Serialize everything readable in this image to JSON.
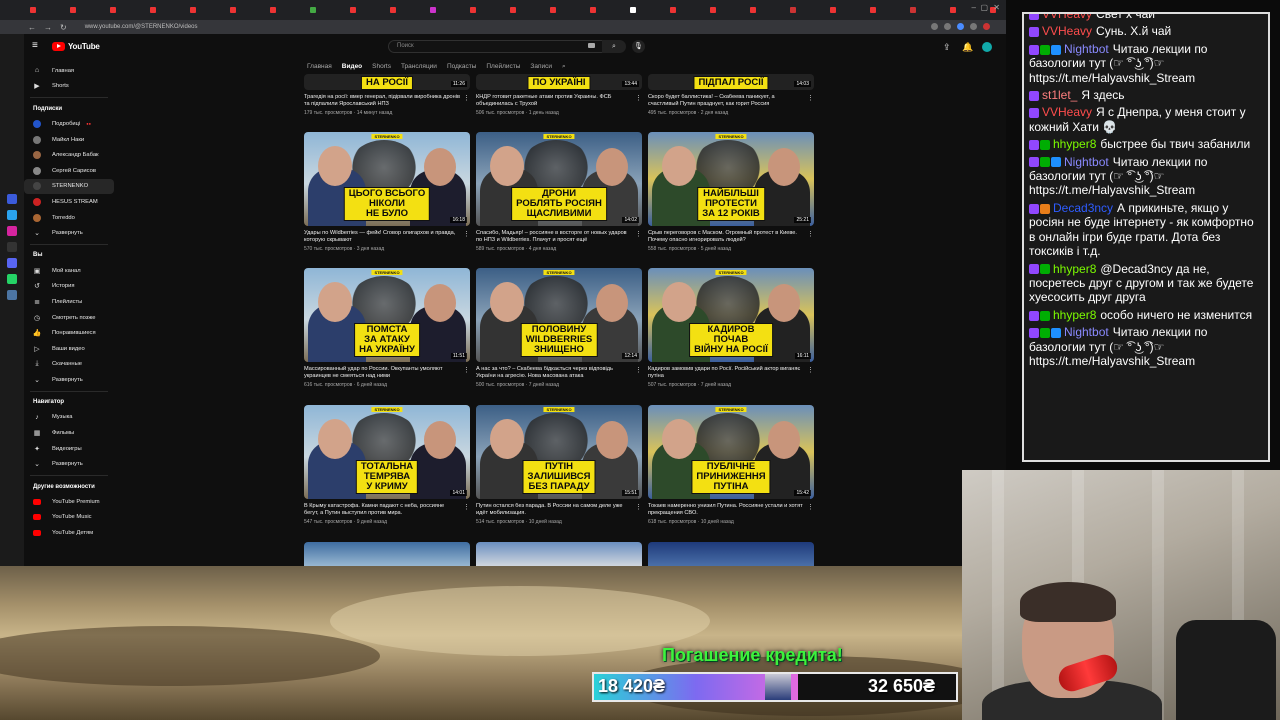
{
  "browser": {
    "url": "www.youtube.com/@STERNENKO/videos",
    "tab_count": 38
  },
  "youtube": {
    "logo": "YouTube",
    "search_placeholder": "Поиск",
    "tabs": [
      "Главная",
      "Видео",
      "Shorts",
      "Трансляции",
      "Подкасты",
      "Плейлисты",
      "Записи"
    ],
    "active_tab": "Видео"
  },
  "sidebar": {
    "main": [
      {
        "label": "Главная",
        "icon": "home-icon"
      },
      {
        "label": "Shorts",
        "icon": "shorts-icon"
      }
    ],
    "subs_title": "Подписки",
    "subs": [
      {
        "label": "Подробиці",
        "color": "#2255cc",
        "live": true
      },
      {
        "label": "Майкл Наки",
        "color": "#777777",
        "live": false
      },
      {
        "label": "Александр Бабак",
        "color": "#996644",
        "live": false
      },
      {
        "label": "Сергей Сарисов",
        "color": "#888888",
        "live": false
      },
      {
        "label": "STERNENKO",
        "color": "#444444",
        "live": false,
        "selected": true
      },
      {
        "label": "HESUS STREAM",
        "color": "#cc2222",
        "live": false
      },
      {
        "label": "Torreddo",
        "color": "#aa6633",
        "live": false
      },
      {
        "label": "Развернуть",
        "color": "",
        "live": false
      }
    ],
    "you_title": "Вы",
    "you": [
      {
        "label": "Мой канал",
        "icon": "user-icon"
      },
      {
        "label": "История",
        "icon": "history-icon"
      },
      {
        "label": "Плейлисты",
        "icon": "playlist-icon"
      },
      {
        "label": "Смотреть позже",
        "icon": "clock-icon"
      },
      {
        "label": "Понравившиеся",
        "icon": "like-icon"
      },
      {
        "label": "Ваши видео",
        "icon": "video-icon"
      },
      {
        "label": "Скачанные",
        "icon": "download-icon"
      },
      {
        "label": "Развернуть",
        "icon": "chevron-down-icon"
      }
    ],
    "nav_title": "Навигатор",
    "nav": [
      {
        "label": "Музыка",
        "icon": "music-icon"
      },
      {
        "label": "Фильмы",
        "icon": "film-icon"
      },
      {
        "label": "Видеоигры",
        "icon": "gamepad-icon"
      },
      {
        "label": "Развернуть",
        "icon": "chevron-down-icon"
      }
    ],
    "more_title": "Другие возможности",
    "more": [
      {
        "label": "YouTube Premium"
      },
      {
        "label": "YouTube Music"
      },
      {
        "label": "YouTube Детям"
      }
    ]
  },
  "top_row": [
    {
      "caption": "НА РОСІЇ",
      "title": "Трагедія на росії: вмер генерал, підірвали виробника дронів та підпалили Ярославський НПЗ",
      "meta": "179 тыс. просмотров · 14 минут назад",
      "dur": "11:26"
    },
    {
      "caption": "ПО УКРАЇНІ",
      "title": "КНДР готовит ракетные атаки против Украины. ФСБ объединилась с Трухой",
      "meta": "506 тыс. просмотров · 1 день назад",
      "dur": "13:44"
    },
    {
      "caption": "ПІДПАЛ РОСІЇ",
      "title": "Скоро будет баллистика! – Скабеева паникует, а счастливый Путин празднует, как горит Россия",
      "meta": "495 тыс. просмотров · 2 дня назад",
      "dur": "14:03"
    }
  ],
  "videos": [
    {
      "caption": [
        "ЦЬОГО ВСЬОГО",
        "НІКОЛИ",
        "НЕ БУЛО"
      ],
      "badge": "STERNENKO",
      "title": "Удары по Wildberries — фейк! Сговор олигархов и правда, которую скрывают",
      "meta": "570 тыс. просмотров · 3 дня назад",
      "dur": "16:18"
    },
    {
      "caption": [
        "ДРОНИ",
        "РОБЛЯТЬ РОСІЯН",
        "ЩАСЛИВИМИ"
      ],
      "badge": "STERNENKO",
      "title": "Спасибо, Мадьяр! – россияне в восторге от новых ударов по НПЗ и Wildberries. Плачут и просят ещё",
      "meta": "589 тыс. просмотров · 4 дня назад",
      "dur": "14:02"
    },
    {
      "caption": [
        "НАЙБІЛЬШІ",
        "ПРОТЕСТИ",
        "ЗА 12 РОКІВ"
      ],
      "badge": "STERNENKO",
      "title": "Срыв переговоров с Маском. Огромный протест в Киеве. Почему опасно игнорировать людей?",
      "meta": "558 тыс. просмотров · 5 дней назад",
      "dur": "25:21"
    },
    {
      "caption": [
        "ПОМСТА",
        "ЗА АТАКУ",
        "НА УКРАЇНУ"
      ],
      "badge": "STERNENKO",
      "title": "Массированный удар по России. Оккупанты умоляют украинцев не смеяться над ними",
      "meta": "616 тыс. просмотров · 6 дней назад",
      "dur": "11:51"
    },
    {
      "caption": [
        "ПОЛОВИНУ",
        "WILDBERRIES",
        "ЗНИЩЕНО"
      ],
      "badge": "STERNENKO",
      "title": "А нас за что? – Скабеева бідкається через відповідь України на агресію. Нова масована атака",
      "meta": "500 тыс. просмотров · 7 дней назад",
      "dur": "12:14"
    },
    {
      "caption": [
        "КАДИРОВ",
        "ПОЧАВ",
        "ВІЙНУ НА РОСІЇ"
      ],
      "badge": "STERNENKO",
      "title": "Кадиров замовив удари по Росії. Російський актор виганяє путіна",
      "meta": "507 тыс. просмотров · 7 дней назад",
      "dur": "16:11"
    },
    {
      "caption": [
        "ТОТАЛЬНА",
        "ТЕМРЯВА",
        "У КРИМУ"
      ],
      "badge": "STERNENKO",
      "title": "В Крыму катастрофа. Камни падают с неба, россияне бегут, а Путин выступил против мира.",
      "meta": "547 тыс. просмотров · 9 дней назад",
      "dur": "14:01"
    },
    {
      "caption": [
        "ПУТІН",
        "ЗАЛИШИВСЯ",
        "БЕЗ ПАРАДУ"
      ],
      "badge": "STERNENKO",
      "title": "Путин остался без парада. В России на самом деле уже идёт мобилизация.",
      "meta": "514 тыс. просмотров · 10 дней назад",
      "dur": "15:51"
    },
    {
      "caption": [
        "ПУБЛІЧНЕ",
        "ПРИНИЖЕННЯ",
        "ПУТІНА"
      ],
      "badge": "STERNENKO",
      "title": "Токаев намеренно унизил Путина. Россияне устали и хотят прекращения СВО.",
      "meta": "618 тыс. просмотров · 10 дней назад",
      "dur": "15:42"
    }
  ],
  "chat": [
    {
      "user": "VVHeavy",
      "color": "#ff4d4d",
      "text": "Свет х чай",
      "badges": [
        "#9147ff"
      ]
    },
    {
      "user": "VVHeavy",
      "color": "#ff4d4d",
      "text": "Сунь. Х.й чай",
      "badges": [
        "#9147ff"
      ]
    },
    {
      "user": "Nightbot",
      "color": "#8a8aff",
      "text": "Читаю лекции по базологии тут (☞ ͡° ͜ʖ ͡°)☞ https://t.me/Halyavshik_Stream",
      "badges": [
        "#9147ff",
        "#00ad03",
        "#1e90ff"
      ]
    },
    {
      "user": "st1let_",
      "color": "#ff7f7f",
      "text": "Я здесь",
      "badges": [
        "#9147ff"
      ]
    },
    {
      "user": "VVHeavy",
      "color": "#ff4d4d",
      "text": "Я с Днепра, у меня стоит у кожний Хати 💀",
      "badges": [
        "#9147ff"
      ]
    },
    {
      "user": "hhyper8",
      "color": "#7cfc00",
      "text": "быстрее бы твич забанили",
      "badges": [
        "#9147ff",
        "#00ad03"
      ]
    },
    {
      "user": "Nightbot",
      "color": "#8a8aff",
      "text": "Читаю лекции по базологии тут (☞ ͡° ͜ʖ ͡°)☞ https://t.me/Halyavshik_Stream",
      "badges": [
        "#9147ff",
        "#00ad03",
        "#1e90ff"
      ]
    },
    {
      "user": "Decad3ncy",
      "color": "#2e5cff",
      "text": "А прикиньте, якщо у росіян не буде інтернету - як комфортно в онлайн ігри буде грати. Дота без токсиків і т.д.",
      "badges": [
        "#9147ff",
        "#e97e1a"
      ]
    },
    {
      "user": "hhyper8",
      "color": "#7cfc00",
      "text": "@Decad3ncy да не, посретесь друг с другом и так же будете хуесосить друг друга",
      "badges": [
        "#9147ff",
        "#00ad03"
      ]
    },
    {
      "user": "hhyper8",
      "color": "#7cfc00",
      "text": "особо ничего не изменится",
      "badges": [
        "#9147ff",
        "#00ad03"
      ]
    },
    {
      "user": "Nightbot",
      "color": "#8a8aff",
      "text": "Читаю лекции по базологии тут (☞ ͡° ͜ʖ ͡°)☞ https://t.me/Halyavshik_Stream",
      "badges": [
        "#9147ff",
        "#00ad03",
        "#1e90ff"
      ]
    }
  ],
  "goal": {
    "title": "Погашение кредита!",
    "current": "18 420₴",
    "target": "32 650₴",
    "progress": 0.564
  }
}
